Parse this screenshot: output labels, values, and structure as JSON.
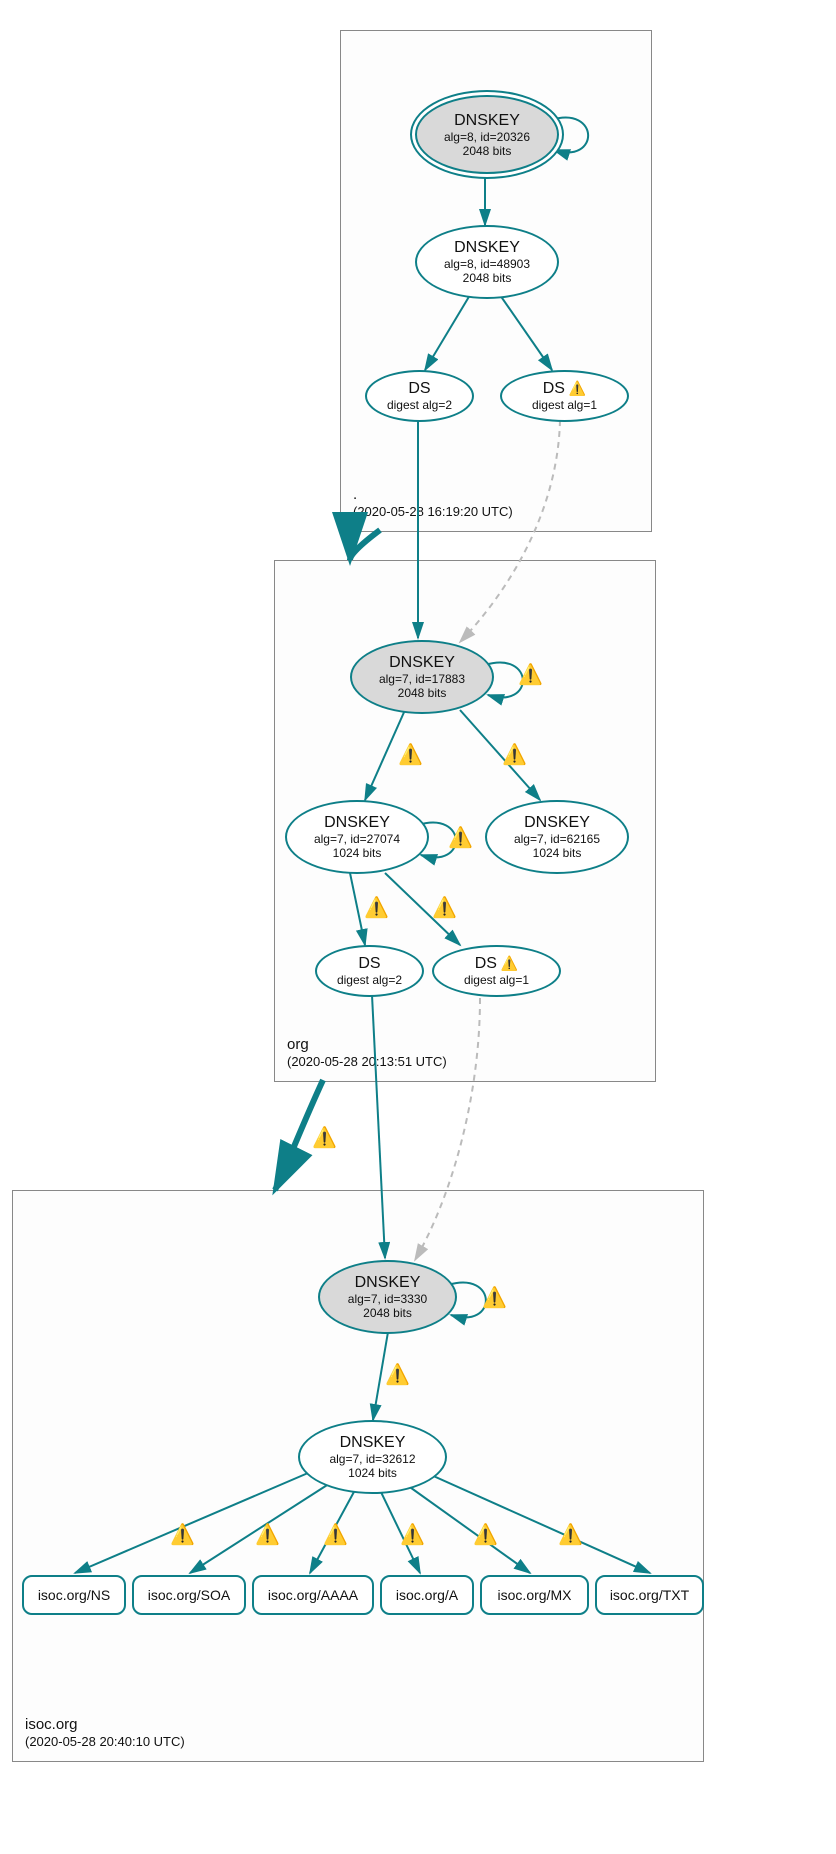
{
  "zones": {
    "root": {
      "name": ".",
      "timestamp": "(2020-05-28 16:19:20 UTC)"
    },
    "org": {
      "name": "org",
      "timestamp": "(2020-05-28 20:13:51 UTC)"
    },
    "isoc": {
      "name": "isoc.org",
      "timestamp": "(2020-05-28 20:40:10 UTC)"
    }
  },
  "nodes": {
    "root_ksk": {
      "title": "DNSKEY",
      "line1": "alg=8, id=20326",
      "line2": "2048 bits"
    },
    "root_zsk": {
      "title": "DNSKEY",
      "line1": "alg=8, id=48903",
      "line2": "2048 bits"
    },
    "root_ds2": {
      "title": "DS",
      "line1": "digest alg=2"
    },
    "root_ds1": {
      "title": "DS",
      "line1": "digest alg=1"
    },
    "org_ksk": {
      "title": "DNSKEY",
      "line1": "alg=7, id=17883",
      "line2": "2048 bits"
    },
    "org_zsk": {
      "title": "DNSKEY",
      "line1": "alg=7, id=27074",
      "line2": "1024 bits"
    },
    "org_key2": {
      "title": "DNSKEY",
      "line1": "alg=7, id=62165",
      "line2": "1024 bits"
    },
    "org_ds2": {
      "title": "DS",
      "line1": "digest alg=2"
    },
    "org_ds1": {
      "title": "DS",
      "line1": "digest alg=1"
    },
    "isoc_ksk": {
      "title": "DNSKEY",
      "line1": "alg=7, id=3330",
      "line2": "2048 bits"
    },
    "isoc_zsk": {
      "title": "DNSKEY",
      "line1": "alg=7, id=32612",
      "line2": "1024 bits"
    },
    "rr_ns": "isoc.org/NS",
    "rr_soa": "isoc.org/SOA",
    "rr_aaaa": "isoc.org/AAAA",
    "rr_a": "isoc.org/A",
    "rr_mx": "isoc.org/MX",
    "rr_txt": "isoc.org/TXT"
  },
  "root_ds1_warn_inline": "⚠️",
  "org_ds1_warn_inline": "⚠️"
}
